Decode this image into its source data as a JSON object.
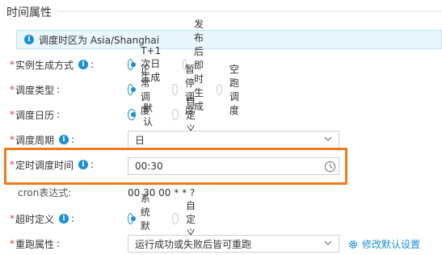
{
  "section": {
    "title": "时间属性"
  },
  "info_bar": {
    "icon": "info-icon",
    "text": "调度时区为 Asia/Shanghai"
  },
  "fields": {
    "instance_mode": {
      "label": "实例生成方式",
      "options": [
        "T+1次日生成",
        "发布后即时生成"
      ],
      "selected": 0
    },
    "schedule_type": {
      "label": "调度类型",
      "options": [
        "正常调度",
        "暂停调度",
        "空跑调度"
      ],
      "selected": 0
    },
    "calendar": {
      "label": "调度日历",
      "options": [
        "默认",
        "自定义"
      ],
      "selected": 0
    },
    "period": {
      "label": "调度周期",
      "value": "日"
    },
    "timed": {
      "label": "定时调度时间",
      "value": "00:30"
    },
    "cron": {
      "label": "cron表达式",
      "value": "00 30 00 * * ?"
    },
    "timeout": {
      "label": "超时定义",
      "options": [
        "系统默认",
        "自定义"
      ],
      "selected": 0
    },
    "rerun": {
      "label": "重跑属性",
      "value": "运行成功或失败后皆可重跑"
    }
  },
  "modify_default_link": {
    "label": "修改默认设置",
    "icon": "gear-icon"
  },
  "colors": {
    "accent": "#1a8fd6",
    "highlight": "#f07a1d",
    "required": "#e4393c"
  },
  "required_mark": "*",
  "colon": ":",
  "info_glyph": "i"
}
